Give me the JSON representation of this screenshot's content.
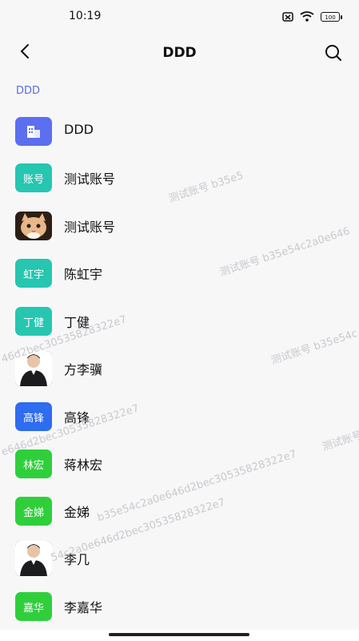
{
  "status_bar": {
    "time": "10:19",
    "battery": "100"
  },
  "header": {
    "title": "DDD"
  },
  "breadcrumb": "DDD",
  "items": [
    {
      "name": "DDD",
      "avatar_text": "",
      "avatar_color": "#5b6ff0",
      "avatar_type": "building"
    },
    {
      "name": "测试账号",
      "avatar_text": "账号",
      "avatar_color": "#26c6b0",
      "avatar_type": "text"
    },
    {
      "name": "测试账号",
      "avatar_text": "",
      "avatar_color": "#e8b98a",
      "avatar_type": "cat-photo"
    },
    {
      "name": "陈虹宇",
      "avatar_text": "虹宇",
      "avatar_color": "#26c6b0",
      "avatar_type": "text"
    },
    {
      "name": "丁健",
      "avatar_text": "丁健",
      "avatar_color": "#26c6b0",
      "avatar_type": "text"
    },
    {
      "name": "方李骥",
      "avatar_text": "",
      "avatar_color": "#222222",
      "avatar_type": "person-photo"
    },
    {
      "name": "高锋",
      "avatar_text": "高锋",
      "avatar_color": "#2e6cf0",
      "avatar_type": "text"
    },
    {
      "name": "蒋林宏",
      "avatar_text": "林宏",
      "avatar_color": "#2fcf3c",
      "avatar_type": "text"
    },
    {
      "name": "金娣",
      "avatar_text": "金娣",
      "avatar_color": "#2fcf3c",
      "avatar_type": "text"
    },
    {
      "name": "李几",
      "avatar_text": "",
      "avatar_color": "#222222",
      "avatar_type": "person-photo"
    },
    {
      "name": "李嘉华",
      "avatar_text": "嘉华",
      "avatar_color": "#2fcf3c",
      "avatar_type": "text"
    }
  ],
  "watermarks": [
    "测试账号 b35e5",
    "测试账号 b35e54c2a0e646",
    "测试账号 b35e54c",
    "测试账号",
    "46d2bec30535828322e7",
    "e646d2bec30535828322e7",
    "54c2a0e646d2bec30535828322e7",
    "b35e54c2a0e646d2bec30535828322e7"
  ]
}
